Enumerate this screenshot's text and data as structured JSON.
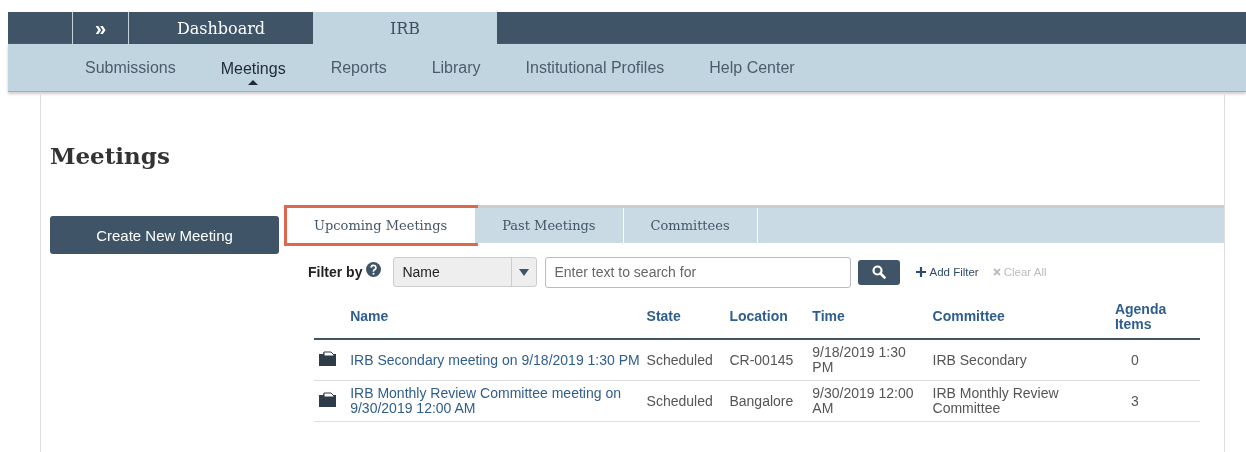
{
  "top_bar": {
    "expand_label": "»",
    "tabs": [
      {
        "label": "Dashboard",
        "selected": false
      },
      {
        "label": "IRB",
        "selected": true
      }
    ]
  },
  "nav": [
    {
      "label": "Submissions",
      "selected": false
    },
    {
      "label": "Meetings",
      "selected": true
    },
    {
      "label": "Reports",
      "selected": false
    },
    {
      "label": "Library",
      "selected": false
    },
    {
      "label": "Institutional Profiles",
      "selected": false
    },
    {
      "label": "Help Center",
      "selected": false
    }
  ],
  "page_title": "Meetings",
  "create_button": "Create New Meeting",
  "tabs": [
    {
      "label": "Upcoming Meetings",
      "selected": true,
      "highlighted": true
    },
    {
      "label": "Past Meetings",
      "selected": false,
      "highlighted": false
    },
    {
      "label": "Committees",
      "selected": false,
      "highlighted": false
    }
  ],
  "filter": {
    "label": "Filter by",
    "field": "Name",
    "search_placeholder": "Enter text to search for",
    "add_filter": "Add Filter",
    "clear_all": "Clear All"
  },
  "table": {
    "columns": [
      "Name",
      "State",
      "Location",
      "Time",
      "Committee",
      "Agenda Items"
    ],
    "rows": [
      {
        "name": "IRB Secondary meeting on 9/18/2019 1:30 PM",
        "state": "Scheduled",
        "location": "CR-00145",
        "time": "9/18/2019 1:30 PM",
        "committee": "IRB Secondary",
        "agenda_items": "0"
      },
      {
        "name": "IRB Monthly Review Committee meeting on 9/30/2019 12:00 AM",
        "state": "Scheduled",
        "location": "Bangalore",
        "time": "9/30/2019 12:00 AM",
        "committee": "IRB Monthly Review Committee",
        "agenda_items": "3"
      }
    ]
  }
}
